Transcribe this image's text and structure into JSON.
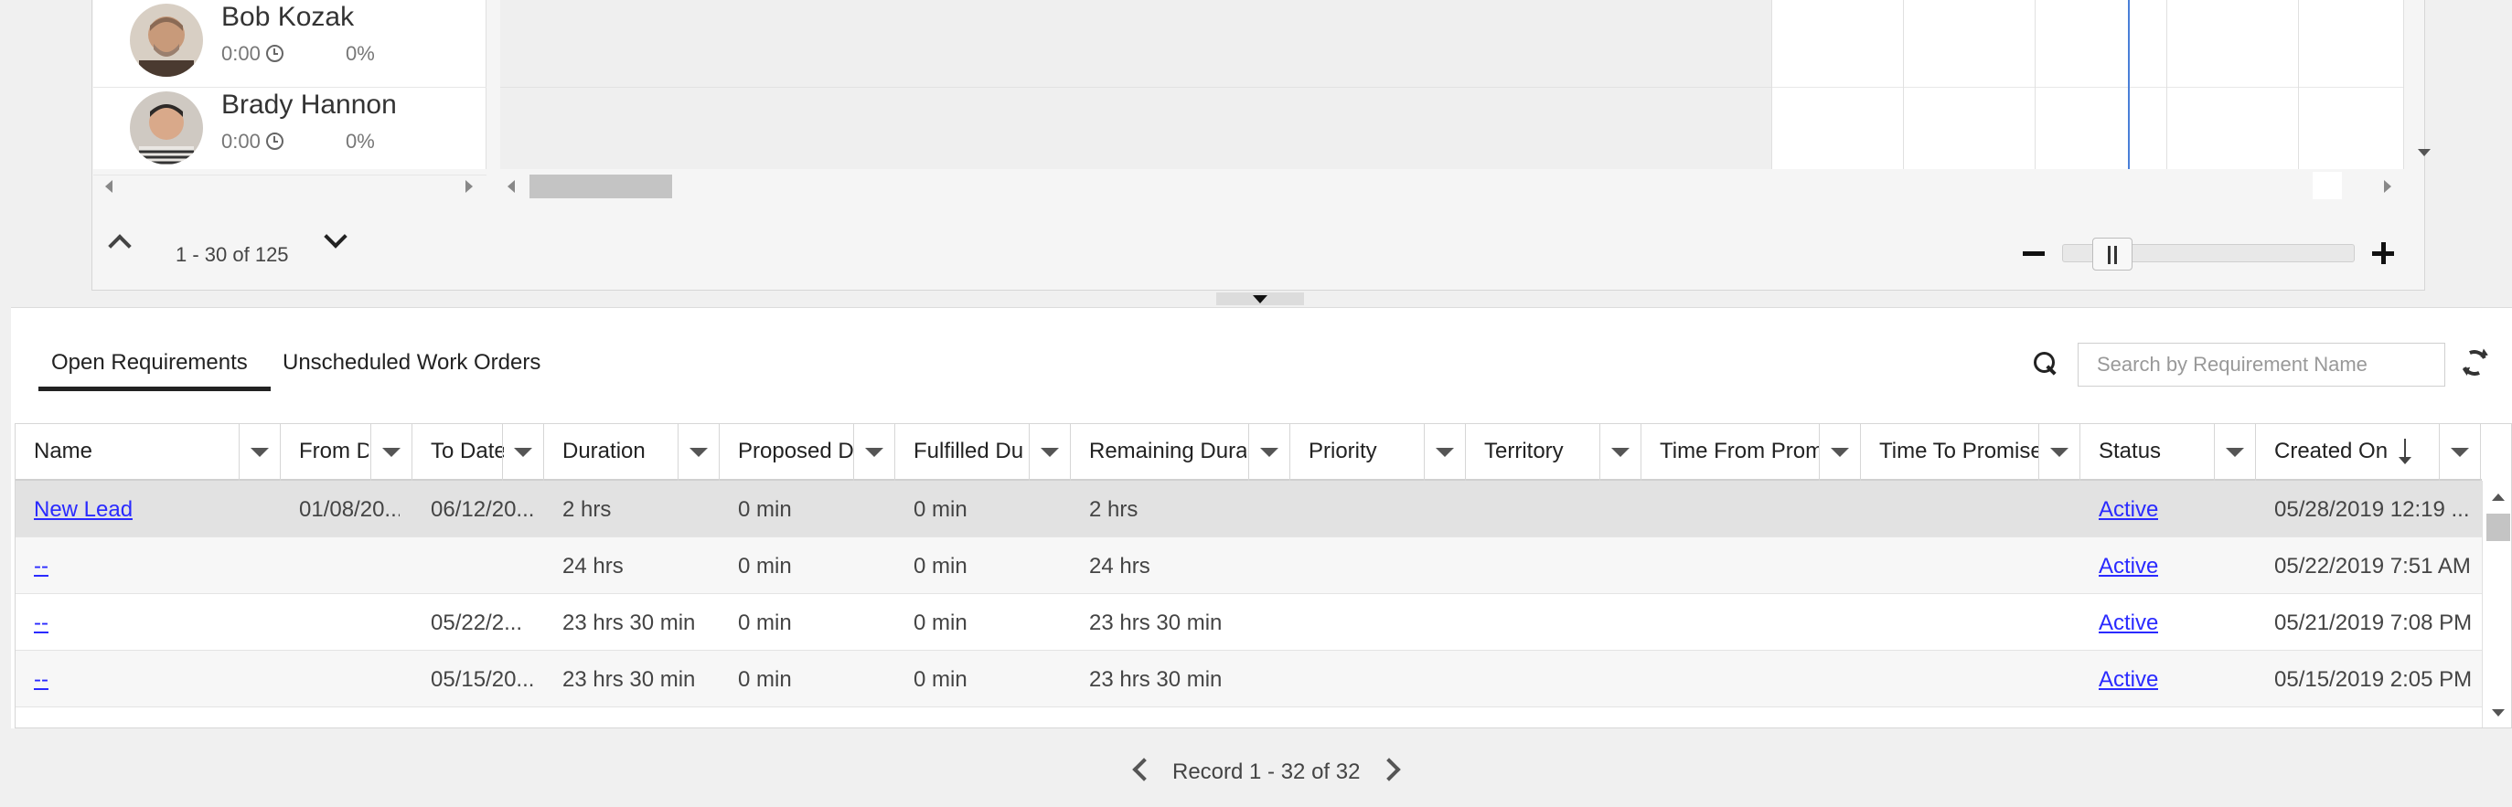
{
  "resources": [
    {
      "name": "Bob Kozak",
      "time": "0:00",
      "percent": "0%"
    },
    {
      "name": "Brady Hannon",
      "time": "0:00",
      "percent": "0%"
    }
  ],
  "pager": {
    "text": "1 - 30 of 125"
  },
  "tabs": [
    {
      "label": "Open Requirements",
      "active": true
    },
    {
      "label": "Unscheduled Work Orders",
      "active": false
    }
  ],
  "search": {
    "placeholder": "Search by Requirement Name"
  },
  "columns": [
    "Name",
    "From D",
    "To Date",
    "Duration",
    "Proposed D",
    "Fulfilled Du",
    "Remaining Dura",
    "Priority",
    "Territory",
    "Time From Prom",
    "Time To Promise",
    "Status",
    "Created On"
  ],
  "rows": [
    {
      "name": "New Lead",
      "from": "01/08/20...",
      "to": "06/12/20...",
      "duration": "2 hrs",
      "proposed": "0 min",
      "fulfilled": "0 min",
      "remaining": "2 hrs",
      "status": "Active",
      "created": "05/28/2019 12:19 ..."
    },
    {
      "name": "--",
      "from": "",
      "to": "",
      "duration": "24 hrs",
      "proposed": "0 min",
      "fulfilled": "0 min",
      "remaining": "24 hrs",
      "status": "Active",
      "created": "05/22/2019 7:51 AM"
    },
    {
      "name": "--",
      "from": "",
      "to": "05/22/2...",
      "duration": "23 hrs 30 min",
      "proposed": "0 min",
      "fulfilled": "0 min",
      "remaining": "23 hrs 30 min",
      "status": "Active",
      "created": "05/21/2019 7:08 PM"
    },
    {
      "name": "--",
      "from": "",
      "to": "05/15/20...",
      "duration": "23 hrs 30 min",
      "proposed": "0 min",
      "fulfilled": "0 min",
      "remaining": "23 hrs 30 min",
      "status": "Active",
      "created": "05/15/2019 2:05 PM"
    }
  ],
  "footer": {
    "text": "Record 1 - 32 of 32"
  },
  "colors": {
    "now_line": "#4a7fd8",
    "link": "#2a2aff",
    "selected_row": "#e2e2e2"
  }
}
